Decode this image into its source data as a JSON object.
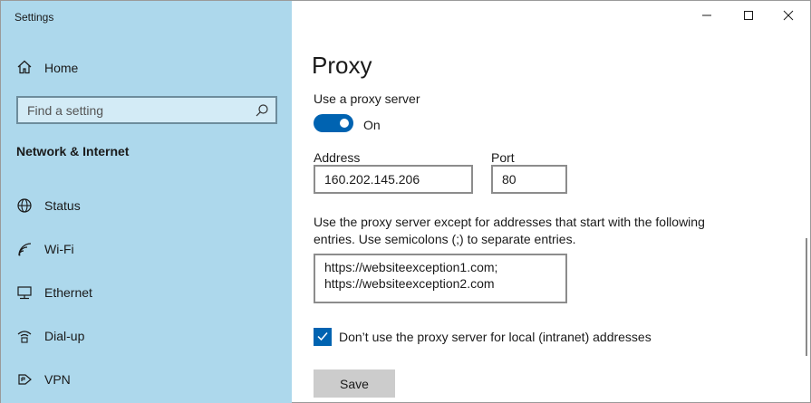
{
  "window": {
    "title": "Settings",
    "controls": {
      "minimize": "minimize",
      "maximize": "maximize",
      "close": "close"
    }
  },
  "sidebar": {
    "home": {
      "label": "Home",
      "icon": "home-icon"
    },
    "search": {
      "placeholder": "Find a setting",
      "value": ""
    },
    "section_title": "Network & Internet",
    "items": [
      {
        "label": "Status",
        "icon": "globe-icon"
      },
      {
        "label": "Wi-Fi",
        "icon": "wifi-icon"
      },
      {
        "label": "Ethernet",
        "icon": "ethernet-icon"
      },
      {
        "label": "Dial-up",
        "icon": "dialup-icon"
      },
      {
        "label": "VPN",
        "icon": "vpn-icon"
      }
    ]
  },
  "main": {
    "title": "Proxy",
    "use_proxy_label": "Use a proxy server",
    "toggle": {
      "state": "On",
      "enabled": true
    },
    "address": {
      "label": "Address",
      "value": "160.202.145.206"
    },
    "port": {
      "label": "Port",
      "value": "80"
    },
    "exceptions_description": "Use the proxy server except for addresses that start with the following entries. Use semicolons (;) to separate entries.",
    "exceptions_value": "https://websiteexception1.com;\nhttps://websiteexception2.com",
    "local_bypass": {
      "label": "Don’t use the proxy server for local (intranet) addresses",
      "checked": true
    },
    "save_label": "Save"
  },
  "colors": {
    "sidebar_bg": "#add8ec",
    "accent": "#0063b1",
    "button_bg": "#cccccc"
  }
}
